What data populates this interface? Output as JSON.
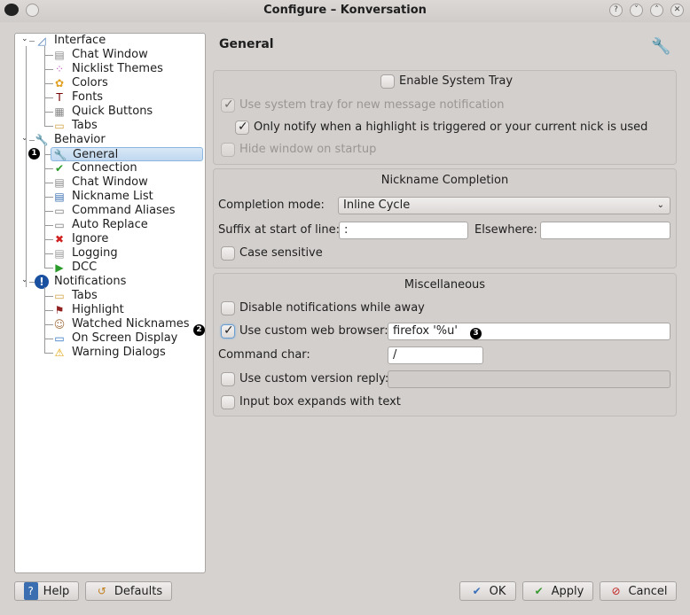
{
  "window": {
    "title": "Configure – Konversation"
  },
  "tree": {
    "groups": [
      {
        "label": "Interface",
        "icon": "interface-icon",
        "items": [
          {
            "label": "Chat Window",
            "icon": "chat-window-icon"
          },
          {
            "label": "Nicklist Themes",
            "icon": "nicklist-themes-icon"
          },
          {
            "label": "Colors",
            "icon": "colors-icon"
          },
          {
            "label": "Fonts",
            "icon": "fonts-icon"
          },
          {
            "label": "Quick Buttons",
            "icon": "quick-buttons-icon"
          },
          {
            "label": "Tabs",
            "icon": "tabs-icon"
          }
        ]
      },
      {
        "label": "Behavior",
        "icon": "wrench-icon",
        "items": [
          {
            "label": "General",
            "icon": "wrench-icon",
            "selected": true
          },
          {
            "label": "Connection",
            "icon": "connection-icon"
          },
          {
            "label": "Chat Window",
            "icon": "chat-window-icon"
          },
          {
            "label": "Nickname List",
            "icon": "nickname-list-icon"
          },
          {
            "label": "Command Aliases",
            "icon": "command-aliases-icon"
          },
          {
            "label": "Auto Replace",
            "icon": "auto-replace-icon"
          },
          {
            "label": "Ignore",
            "icon": "ignore-icon"
          },
          {
            "label": "Logging",
            "icon": "logging-icon"
          },
          {
            "label": "DCC",
            "icon": "dcc-icon"
          }
        ]
      },
      {
        "label": "Notifications",
        "icon": "info-icon",
        "items": [
          {
            "label": "Tabs",
            "icon": "tabs-icon"
          },
          {
            "label": "Highlight",
            "icon": "flag-icon"
          },
          {
            "label": "Watched Nicknames",
            "icon": "watched-nicknames-icon"
          },
          {
            "label": "On Screen Display",
            "icon": "monitor-icon"
          },
          {
            "label": "Warning Dialogs",
            "icon": "warning-icon"
          }
        ]
      }
    ]
  },
  "badges": {
    "b1": "1",
    "b2": "2",
    "b3": "3"
  },
  "page": {
    "title": "General"
  },
  "tray": {
    "enable": "Enable System Tray",
    "enable_checked": false,
    "use_tray": "Use system tray for new message notification",
    "use_tray_checked": true,
    "only_notify": "Only notify when a highlight is triggered or your current nick is used",
    "only_notify_checked": true,
    "hide_window": "Hide window on startup",
    "hide_window_checked": false
  },
  "nick": {
    "title": "Nickname Completion",
    "mode_label": "Completion mode:",
    "mode_value": "Inline Cycle",
    "suffix_label": "Suffix at start of line:",
    "suffix_value": ":",
    "elsewhere_label": "Elsewhere:",
    "elsewhere_value": "",
    "case": "Case sensitive",
    "case_checked": false
  },
  "misc": {
    "title": "Miscellaneous",
    "disable": "Disable notifications while away",
    "disable_checked": false,
    "browser": "Use custom web browser:",
    "browser_checked": true,
    "browser_value": "firefox '%u'",
    "cmdchar_label": "Command char:",
    "cmdchar_value": "/",
    "version": "Use custom version reply:",
    "version_checked": false,
    "version_value": "",
    "expand": "Input box expands with text",
    "expand_checked": false
  },
  "buttons": {
    "help": "Help",
    "defaults": "Defaults",
    "ok": "OK",
    "apply": "Apply",
    "cancel": "Cancel"
  }
}
